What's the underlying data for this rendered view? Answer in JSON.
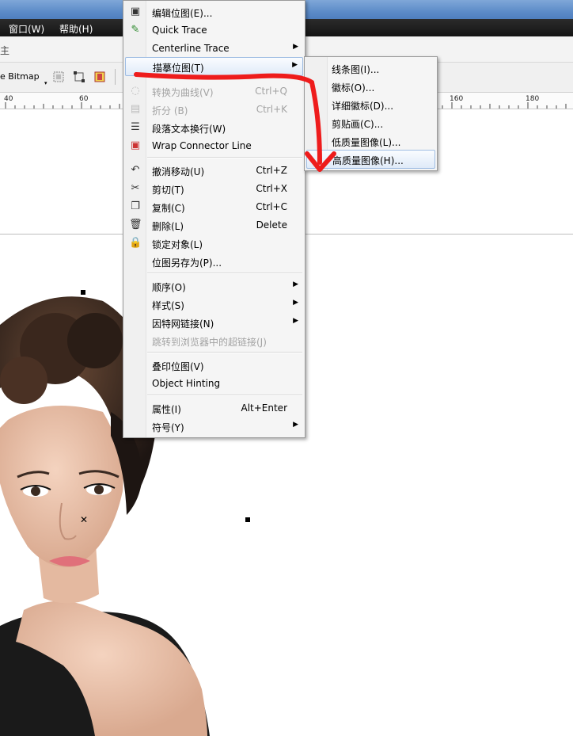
{
  "menubar": {
    "window": "窗口(W)",
    "help": "帮助(H)"
  },
  "toolbar": {
    "trace_bitmap": "e Bitmap",
    "cut_text": "主"
  },
  "ruler": {
    "ticks": [
      "40",
      "60",
      "160",
      "180"
    ]
  },
  "context_menu": {
    "items": [
      {
        "label": "编辑位图(E)...",
        "icon": "edit-bitmap-icon"
      },
      {
        "label": "Quick Trace",
        "icon": "quick-trace-icon"
      },
      {
        "label": "Centerline Trace",
        "submenu": true
      },
      {
        "label": "描摹位图(T)",
        "submenu": true
      },
      {
        "label": "转换为曲线(V)",
        "shortcut": "Ctrl+Q",
        "disabled": true,
        "icon": "convert-curves-icon"
      },
      {
        "label": "折分 (B)",
        "shortcut": "Ctrl+K",
        "disabled": true,
        "icon": "break-apart-icon"
      },
      {
        "label": "段落文本换行(W)",
        "icon": "wrap-text-icon"
      },
      {
        "label": "Wrap Connector Line",
        "icon": "wrap-connector-icon"
      },
      {
        "label": "撤消移动(U)",
        "shortcut": "Ctrl+Z",
        "icon": "undo-icon"
      },
      {
        "label": "剪切(T)",
        "shortcut": "Ctrl+X",
        "icon": "scissors-icon"
      },
      {
        "label": "复制(C)",
        "shortcut": "Ctrl+C",
        "icon": "copy-icon"
      },
      {
        "label": "删除(L)",
        "shortcut": "Delete",
        "icon": "trash-icon"
      },
      {
        "label": "锁定对象(L)",
        "icon": "lock-icon"
      },
      {
        "label": "位图另存为(P)..."
      },
      {
        "label": "顺序(O)",
        "submenu": true
      },
      {
        "label": "样式(S)",
        "submenu": true
      },
      {
        "label": "因特网链接(N)",
        "submenu": true
      },
      {
        "label": "跳转到浏览器中的超链接(J)",
        "disabled": true
      },
      {
        "label": "叠印位图(V)"
      },
      {
        "label": "Object Hinting"
      },
      {
        "label": "属性(I)",
        "shortcut": "Alt+Enter"
      },
      {
        "label": "符号(Y)",
        "submenu": true
      }
    ]
  },
  "trace_submenu": {
    "items": [
      {
        "label": "线条图(I)..."
      },
      {
        "label": "徽标(O)..."
      },
      {
        "label": "详细徽标(D)..."
      },
      {
        "label": "剪贴画(C)..."
      },
      {
        "label": "低质量图像(L)..."
      },
      {
        "label": "高质量图像(H)...",
        "highlighted": true
      }
    ]
  },
  "annotation": {
    "arrow_color": "#ee1c1c"
  }
}
